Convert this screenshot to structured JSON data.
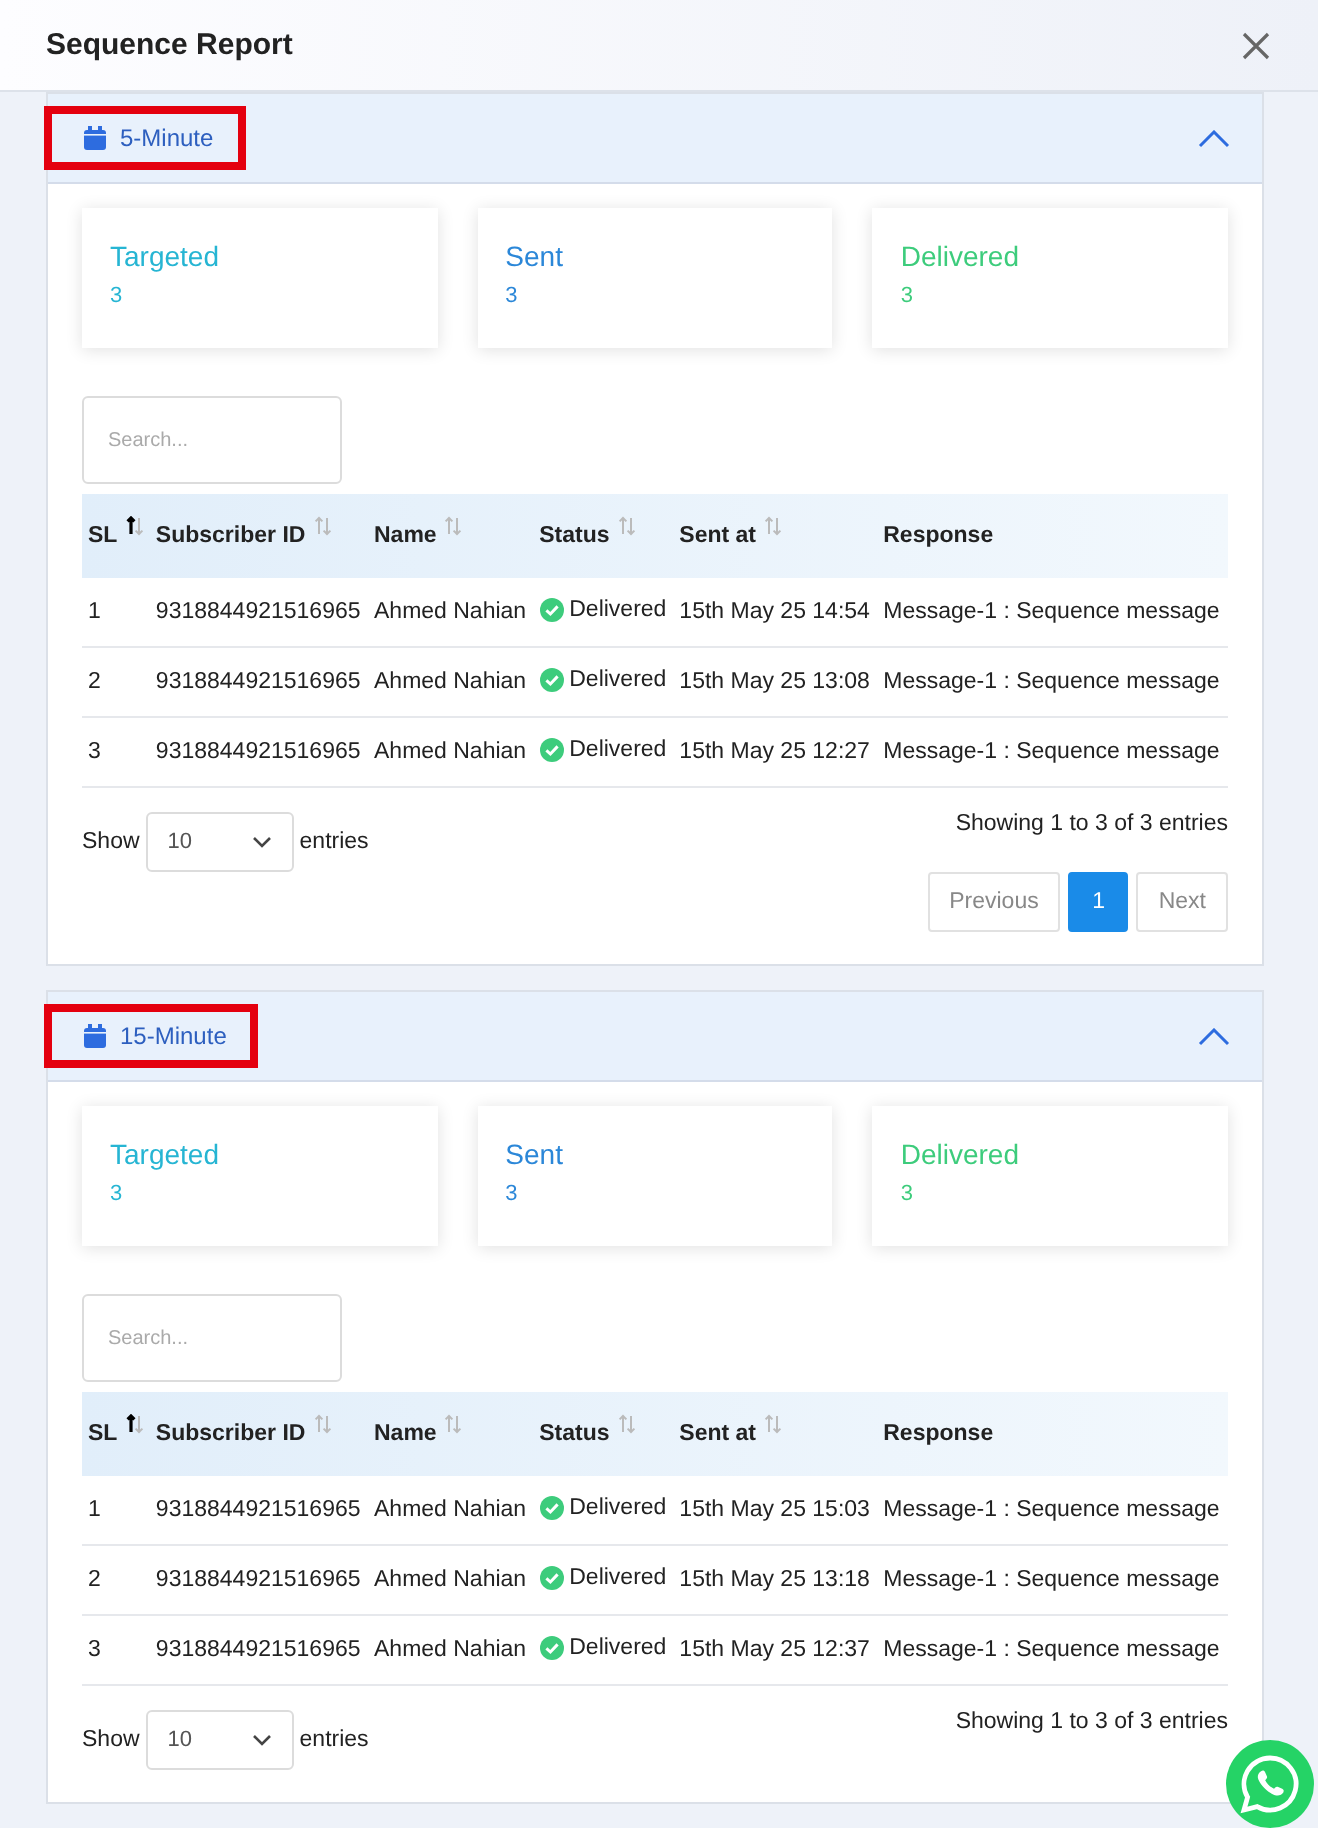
{
  "window": {
    "title": "Sequence Report"
  },
  "sections": [
    {
      "title": "5-Minute",
      "highlighted": true,
      "expanded": true,
      "stats": [
        {
          "label": "Targeted",
          "value": "3",
          "color": "#26b5d3"
        },
        {
          "label": "Sent",
          "value": "3",
          "color": "#2b87d8"
        },
        {
          "label": "Delivered",
          "value": "3",
          "color": "#3dcc7c"
        }
      ],
      "search": {
        "placeholder": "Search..."
      },
      "columns": [
        {
          "label": "SL",
          "sortable": true,
          "sorted": true
        },
        {
          "label": "Subscriber ID",
          "sortable": true,
          "sorted": false
        },
        {
          "label": "Name",
          "sortable": true,
          "sorted": false
        },
        {
          "label": "Status",
          "sortable": true,
          "sorted": false
        },
        {
          "label": "Sent at",
          "sortable": true,
          "sorted": false
        },
        {
          "label": "Response",
          "sortable": false,
          "sorted": false
        }
      ],
      "rows": [
        {
          "sl": "1",
          "subscriber_id": "9318844921516965",
          "name": "Ahmed Nahian",
          "status": "Delivered",
          "delivered": true,
          "sent_at": "15th May 25 14:54",
          "response": "Message-1 : Sequence message"
        },
        {
          "sl": "2",
          "subscriber_id": "9318844921516965",
          "name": "Ahmed Nahian",
          "status": "Delivered",
          "delivered": true,
          "sent_at": "15th May 25 13:08",
          "response": "Message-1 : Sequence message"
        },
        {
          "sl": "3",
          "subscriber_id": "9318844921516965",
          "name": "Ahmed Nahian",
          "status": "Delivered",
          "delivered": true,
          "sent_at": "15th May 25 12:27",
          "response": "Message-1 : Sequence message"
        }
      ],
      "length": {
        "show": "Show",
        "value": "10",
        "entries": "entries"
      },
      "info": "Showing 1 to 3 of 3 entries",
      "pagination": [
        {
          "label": "Previous",
          "selected": false
        },
        {
          "label": "1",
          "selected": true
        },
        {
          "label": "Next",
          "selected": false
        }
      ]
    },
    {
      "title": "15-Minute",
      "highlighted": true,
      "expanded": true,
      "stats": [
        {
          "label": "Targeted",
          "value": "3",
          "color": "#26b5d3"
        },
        {
          "label": "Sent",
          "value": "3",
          "color": "#2b87d8"
        },
        {
          "label": "Delivered",
          "value": "3",
          "color": "#3dcc7c"
        }
      ],
      "search": {
        "placeholder": "Search..."
      },
      "columns": [
        {
          "label": "SL",
          "sortable": true,
          "sorted": true
        },
        {
          "label": "Subscriber ID",
          "sortable": true,
          "sorted": false
        },
        {
          "label": "Name",
          "sortable": true,
          "sorted": false
        },
        {
          "label": "Status",
          "sortable": true,
          "sorted": false
        },
        {
          "label": "Sent at",
          "sortable": true,
          "sorted": false
        },
        {
          "label": "Response",
          "sortable": false,
          "sorted": false
        }
      ],
      "rows": [
        {
          "sl": "1",
          "subscriber_id": "9318844921516965",
          "name": "Ahmed Nahian",
          "status": "Delivered",
          "delivered": true,
          "sent_at": "15th May 25 15:03",
          "response": "Message-1 : Sequence message"
        },
        {
          "sl": "2",
          "subscriber_id": "9318844921516965",
          "name": "Ahmed Nahian",
          "status": "Delivered",
          "delivered": true,
          "sent_at": "15th May 25 13:18",
          "response": "Message-1 : Sequence message"
        },
        {
          "sl": "3",
          "subscriber_id": "9318844921516965",
          "name": "Ahmed Nahian",
          "status": "Delivered",
          "delivered": true,
          "sent_at": "15th May 25 12:37",
          "response": "Message-1 : Sequence message"
        }
      ],
      "length": {
        "show": "Show",
        "value": "10",
        "entries": "entries"
      },
      "info": "Showing 1 to 3 of 3 entries"
    }
  ]
}
